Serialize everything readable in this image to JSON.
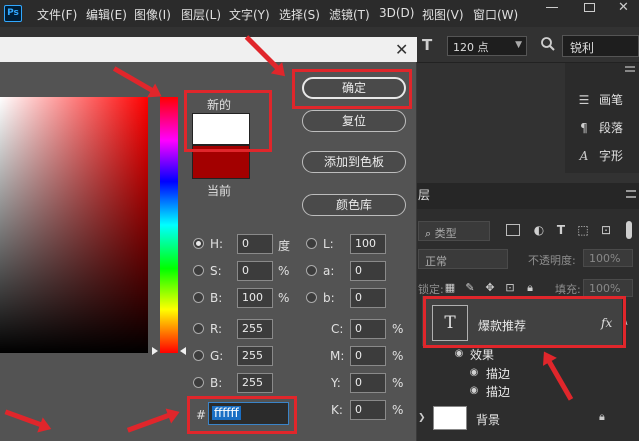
{
  "menubar": {
    "logo": "Ps",
    "items": [
      "文件(F)",
      "编辑(E)",
      "图像(I)",
      "图层(L)",
      "文字(Y)",
      "选择(S)",
      "滤镜(T)",
      "3D(D)",
      "视图(V)",
      "窗口(W)"
    ]
  },
  "options_bar": {
    "tool_icon": "T",
    "font_size": "120 点",
    "search_value": "锐利"
  },
  "character_panel": {
    "items": [
      {
        "icon": "paragraph-style-icon",
        "label": "画笔"
      },
      {
        "icon": "paragraph-icon",
        "label": "段落"
      },
      {
        "icon": "character-icon",
        "label": "字形"
      }
    ]
  },
  "dialog": {
    "new_label": "新的",
    "current_label": "当前",
    "new_color": "#ffffff",
    "current_color": "#a30000",
    "buttons": {
      "ok": "确定",
      "reset": "复位",
      "add_swatch": "添加到色板",
      "color_library": "颜色库"
    },
    "fields": {
      "H": {
        "label": "H:",
        "value": "0",
        "unit": "度"
      },
      "S": {
        "label": "S:",
        "value": "0",
        "unit": "%"
      },
      "B": {
        "label": "B:",
        "value": "100",
        "unit": "%"
      },
      "R": {
        "label": "R:",
        "value": "255"
      },
      "G": {
        "label": "G:",
        "value": "255"
      },
      "Bl": {
        "label": "B:",
        "value": "255"
      },
      "L": {
        "label": "L:",
        "value": "100"
      },
      "a": {
        "label": "a:",
        "value": "0"
      },
      "b": {
        "label": "b:",
        "value": "0"
      },
      "C": {
        "label": "C:",
        "value": "0",
        "unit": "%"
      },
      "M": {
        "label": "M:",
        "value": "0",
        "unit": "%"
      },
      "Y": {
        "label": "Y:",
        "value": "0",
        "unit": "%"
      },
      "K": {
        "label": "K:",
        "value": "0",
        "unit": "%"
      }
    },
    "hex_label": "#",
    "hex_value": "ffffff"
  },
  "layers_panel": {
    "tab": "层",
    "filter_placeholder": "类型",
    "blend_mode": "正常",
    "opacity_label": "不透明度:",
    "opacity_value": "100%",
    "lock_label": "锁定:",
    "fill_label": "填充:",
    "fill_value": "100%",
    "text_layer_name": "爆款推荐",
    "fx_label": "fx",
    "effects_label": "效果",
    "stroke1": "描边",
    "stroke2": "描边",
    "bg_layer_name": "背景"
  },
  "colors": {
    "annotation_red": "#e0262b",
    "selection_blue": "#1a6fc4"
  }
}
